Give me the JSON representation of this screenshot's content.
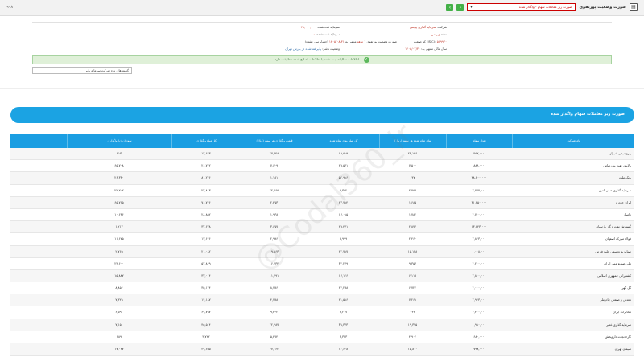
{
  "topbar": {
    "left_text": "۹۹۸",
    "title": "صورت وضعیت پورتفوی",
    "select_value": "صورت ریز معاملات سهام - واگذار شده",
    "prev_arrow": "›",
    "next_arrow": "‹",
    "page_icon": "▤"
  },
  "info": {
    "company_label": "شرکت:",
    "company_value": "سرمایه گذاری پرنس",
    "symbol_label": "نماد:",
    "symbol_value": "وپرنس",
    "isic_label": "کد صنعت (ISIC):",
    "isic_value": "۵۶۹۹۳۰",
    "report_label": "صورت وضعیت پورتفوی",
    "period_text": "۱ ماهه",
    "period_end_label": "منتهی به",
    "period_end_value": "۱۴۰۵/۰۸/۳۱",
    "audit_status": "(حسابرسی نشده)",
    "fiscal_label": "سال مالی منتهی به:",
    "fiscal_value": "۱۴۰۵/۰۲/۳۰",
    "capital_reg_label": "سرمایه ثبت شده:",
    "capital_reg_value": "۲۵,۰۰۰,۰۰۰",
    "capital_unreg_label": "سرمایه ثبت نشده:",
    "capital_unreg_value": "۰",
    "status_label": "وضعیت ناشر:",
    "status_value": "پذیرفته شده در بورس تهران"
  },
  "notice": "اطلاعات سالیانه ثبت شده با اطلاعات اصلاح شده مطابقت دارد.",
  "filter_input": "گزینه های نوع شرکت سرمایه پذیر",
  "report_title": "صورت ریز معاملات سهام واگذار شده",
  "table": {
    "headers": [
      "نام شرکت",
      "تعداد سهام",
      "بهای تمام شده هر سهم (ریال)",
      "کل مبلغ بهای تمام شده",
      "قیمت واگذاری هر سهم (ریال)",
      "کل مبلغ واگذاری",
      "سود (زیان) واگذاری"
    ],
    "rows": [
      [
        "پتروشیمی شیراز",
        "۴۵۷,۰۰۰",
        "۲۳,۱۴۶",
        "۱۵,۵۰۹",
        "۲۷,۲۴۸",
        "۱۲,۶۶۳",
        "۲۱۳"
      ],
      [
        "پالایش نفت بندرعباس",
        "۸۸۹,۰۰۰",
        "۷,۵۰۰",
        "۲۹,۵۶۱",
        "۷,۶۰۹",
        "۲۶,۷۶۲",
        "۶۵,۷۰۸"
      ],
      [
        "بانک ملت",
        "۴۸,۲۰۰,۰۰۰",
        "۶۴۷",
        "۵۲,۹۱۶",
        "۱,۱۷۱",
        "۸۱,۲۴۶",
        "۲۶,۳۳۰"
      ],
      [
        "سرمایه گذاری صدر تامین",
        "۲,۷۷۷,۰۰۰",
        "۲,۷۵۵",
        "۸,۳۵۲",
        "۲۲,۷۶۵",
        "۲۲,۸۱۳",
        "۲۲,۷۰۲"
      ],
      [
        "ایران خودرو",
        "۳۱,۲۵۰,۰۰۰",
        "۱,۶۸۵",
        "۲۳,۷۱۴",
        "۲,۴۵۳",
        "۷۶,۷۶۶",
        "۶۵,۷۶۵"
      ],
      [
        "زامیاد",
        "۴,۷۰۰,۰۰۰",
        "۱,۷۸۲",
        "۱۷,۰۱۵",
        "۱,۹۳۸",
        "۲۸,۸۵۲",
        "۱۰,۶۳۶"
      ],
      [
        "گسترش نفت و گاز پارسیان",
        "۱۳,۸۴۳,۰۰۰",
        "۲,۸۷۴",
        "۲۹,۴۶۱",
        "۳,۶۵۷",
        "۳۲,۶۷۸",
        "۱,۲۱۷"
      ],
      [
        "فولاد مبارکه اصفهان",
        "۲,۸۴۳,۰۰۰",
        "۲,۴۶۰",
        "۸,۹۹۹",
        "۲,۹۹۶",
        "۱۳,۶۶۶",
        "۱۱,۶۷۵"
      ],
      [
        "صنایع پتروشیمی خلیج فارس",
        "۱,۰۰۸,۰۰۰",
        "۱۵,۱۲۸",
        "۲۲,۷۱۷",
        "۱۹,۵۶۳",
        "۲۰,۰۸۲",
        "۲,۷۶۵"
      ],
      [
        "ملی صنایع مس ایران",
        "۴,۲۰۰,۰۰۰",
        "۹,۳۵۶",
        "۳۴,۲۶۹",
        "۱۶,۷۳۴",
        "۵۷,۸۶۹",
        "۲۳,۶۰۰"
      ],
      [
        "کشتیرانی جمهوری اسلامی",
        "۲,۸۰۰,۰۰۰",
        "۶,۱۱۷",
        "۱۷,۱۲۶",
        "۱۱,۷۹۱",
        "۳۳,۰۱۴",
        "۱۵,۸۸۷"
      ],
      [
        "گل گهر",
        "۴,۰۰۰,۰۰۰",
        "۶,۷۲۲",
        "۲۶,۲۸۸",
        "۸,۷۸۶",
        "۳۵,۱۴۴",
        "۸,۸۵۶"
      ],
      [
        "معدنی و صنعتی چادرملو",
        "۲,۹۶۳,۰۰۰",
        "۷,۲۶۱",
        "۲۱,۵۱۶",
        "۴,۷۸۸",
        "۱۴,۱۸۷",
        "۷,۳۲۹"
      ],
      [
        "مخابرات ایران",
        "۷,۴۰۰,۰۰۰",
        "۴۳۲",
        "۳,۲۰۷",
        "۹,۴۳۲",
        "۶۹,۷۹۷",
        "۶,۵۹۰"
      ],
      [
        "سرمایه گذاری غدیر",
        "۱,۹۸۰,۰۰۰",
        "۱۹,۳۷۵",
        "۳۸,۳۶۳",
        "۲۲,۹۸۷",
        "۴۵,۵۱۴",
        "۷,۱۵۱"
      ],
      [
        "کارخانجات داروپخش",
        "۶۸۰,۰۰۰",
        "۴,۹۰۲",
        "۳,۳۳۳",
        "۵,۴۷۴",
        "۳,۷۲۲",
        "۳۸۹"
      ],
      [
        "سیمان تهران",
        "۷۹۸,۰۰۰",
        "۱۵,۸۰۰",
        "۱۲,۶۰۸",
        "۳۷,۱۶۲",
        "۲۹,۶۵۵",
        "۱۷,۰۴۷"
      ]
    ]
  },
  "watermark": "@Codal360_ir"
}
